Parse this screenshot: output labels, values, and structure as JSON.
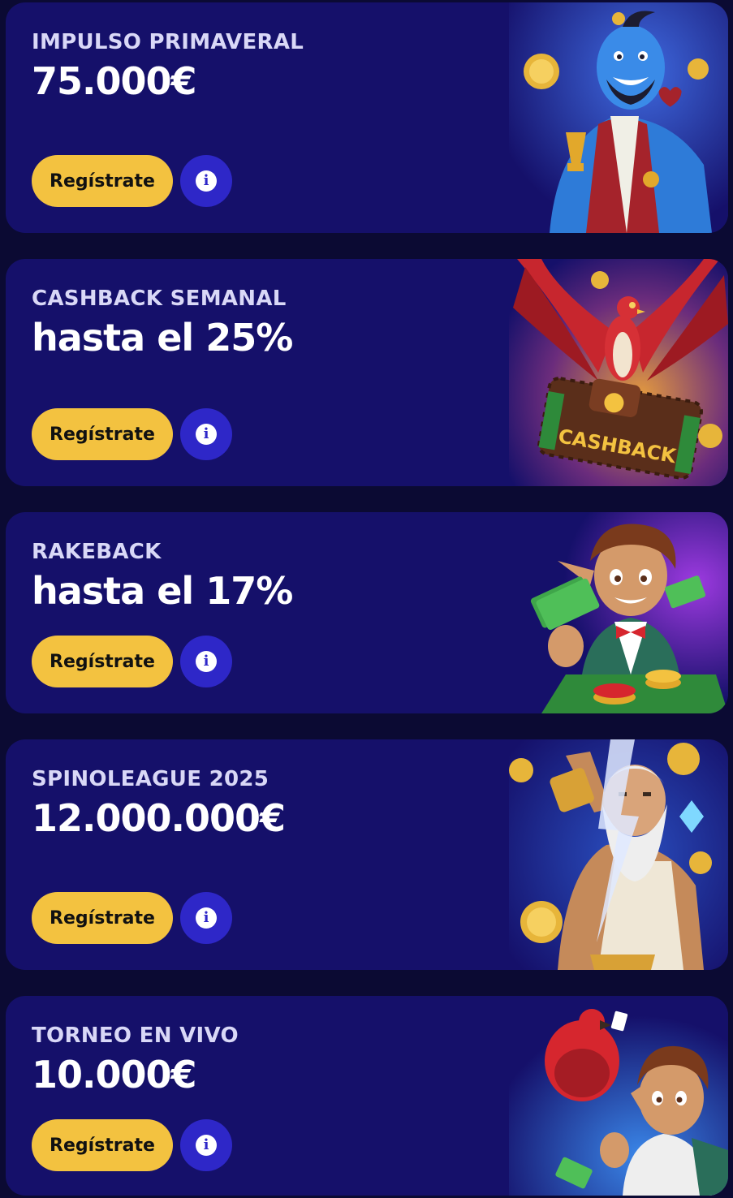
{
  "promos": [
    {
      "title": "IMPULSO PRIMAVERAL",
      "amount": "75.000€",
      "button_label": "Regístrate",
      "info_symbol": "i",
      "illustration": "genie-trophy"
    },
    {
      "title": "CASHBACK SEMANAL",
      "amount": "hasta el 25%",
      "button_label": "Regístrate",
      "info_symbol": "i",
      "illustration": "phoenix-cashback-wallet",
      "illustration_text": "CASHBACK"
    },
    {
      "title": "RAKEBACK",
      "amount": "hasta el 17%",
      "button_label": "Regístrate",
      "info_symbol": "i",
      "illustration": "elf-with-cash"
    },
    {
      "title": "SPINOLEAGUE 2025",
      "amount": "12.000.000€",
      "button_label": "Regístrate",
      "info_symbol": "i",
      "illustration": "zeus-lightning"
    },
    {
      "title": "TORNEO EN VIVO",
      "amount": "10.000€",
      "button_label": "Regístrate",
      "info_symbol": "i",
      "illustration": "parrot-and-elf"
    }
  ],
  "colors": {
    "page_bg": "#0b0a33",
    "card_bg": "#15106a",
    "button_bg": "#f3c240",
    "info_bg": "#2e27c8"
  }
}
